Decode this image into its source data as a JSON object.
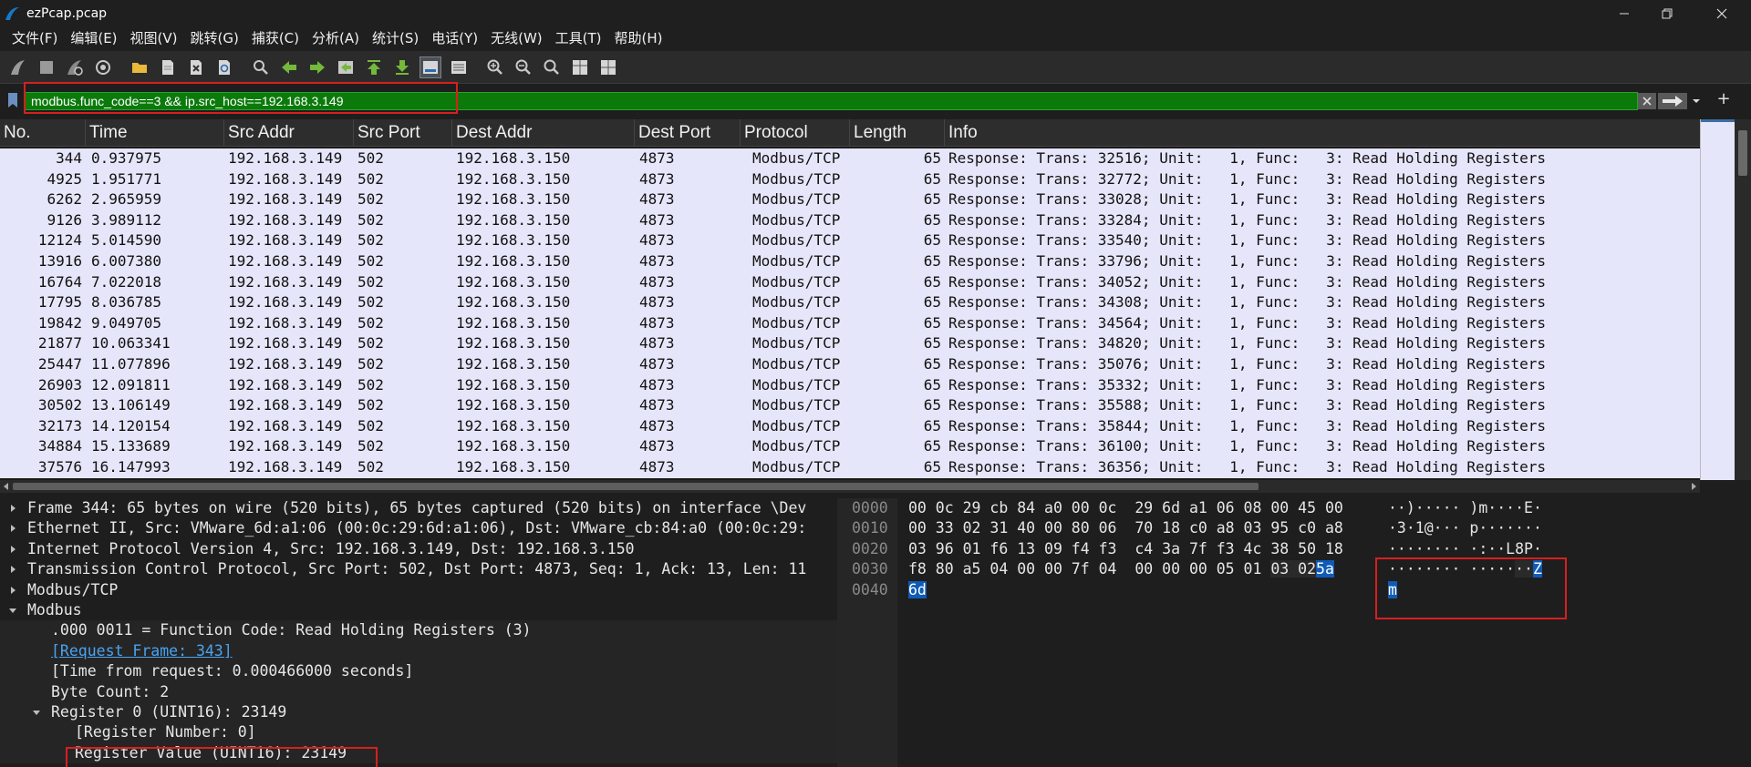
{
  "window": {
    "title": "ezPcap.pcap",
    "colors": {
      "accent_green": "#0b7a0b",
      "row_bg": "#e6e6fa",
      "highlight_blue": "#0f5bb5",
      "annotation_red": "#d81f1f"
    }
  },
  "menu": [
    "文件(F)",
    "编辑(E)",
    "视图(V)",
    "跳转(G)",
    "捕获(C)",
    "分析(A)",
    "统计(S)",
    "电话(Y)",
    "无线(W)",
    "工具(T)",
    "帮助(H)"
  ],
  "toolbar": {
    "icons": [
      "shark-fin-start-icon",
      "stop-icon",
      "restart-icon",
      "options-gear-icon",
      "open-folder-icon",
      "file-icon",
      "close-file-icon",
      "reload-icon",
      "find-icon",
      "back-arrow-icon",
      "forward-arrow-icon",
      "goto-packet-icon",
      "first-packet-icon",
      "last-packet-icon",
      "autoscroll-icon",
      "colorize-icon",
      "zoom-in-icon",
      "zoom-out-icon",
      "zoom-normal-icon",
      "resize-columns-icon",
      "layout-icon"
    ]
  },
  "filter": {
    "value": "modbus.func_code==3 && ip.src_host==192.168.3.149"
  },
  "packet_list": {
    "columns": [
      "No.",
      "Time",
      "Src Addr",
      "Src Port",
      "Dest Addr",
      "Dest Port",
      "Protocol",
      "Length",
      "Info"
    ],
    "rows": [
      {
        "no": "344",
        "time": "0.937975",
        "src": "192.168.3.149",
        "sport": "502",
        "dst": "192.168.3.150",
        "dport": "4873",
        "proto": "Modbus/TCP",
        "len": "65",
        "info": "Response: Trans: 32516; Unit:   1, Func:   3: Read Holding Registers"
      },
      {
        "no": "4925",
        "time": "1.951771",
        "src": "192.168.3.149",
        "sport": "502",
        "dst": "192.168.3.150",
        "dport": "4873",
        "proto": "Modbus/TCP",
        "len": "65",
        "info": "Response: Trans: 32772; Unit:   1, Func:   3: Read Holding Registers"
      },
      {
        "no": "6262",
        "time": "2.965959",
        "src": "192.168.3.149",
        "sport": "502",
        "dst": "192.168.3.150",
        "dport": "4873",
        "proto": "Modbus/TCP",
        "len": "65",
        "info": "Response: Trans: 33028; Unit:   1, Func:   3: Read Holding Registers"
      },
      {
        "no": "9126",
        "time": "3.989112",
        "src": "192.168.3.149",
        "sport": "502",
        "dst": "192.168.3.150",
        "dport": "4873",
        "proto": "Modbus/TCP",
        "len": "65",
        "info": "Response: Trans: 33284; Unit:   1, Func:   3: Read Holding Registers"
      },
      {
        "no": "12124",
        "time": "5.014590",
        "src": "192.168.3.149",
        "sport": "502",
        "dst": "192.168.3.150",
        "dport": "4873",
        "proto": "Modbus/TCP",
        "len": "65",
        "info": "Response: Trans: 33540; Unit:   1, Func:   3: Read Holding Registers"
      },
      {
        "no": "13916",
        "time": "6.007380",
        "src": "192.168.3.149",
        "sport": "502",
        "dst": "192.168.3.150",
        "dport": "4873",
        "proto": "Modbus/TCP",
        "len": "65",
        "info": "Response: Trans: 33796; Unit:   1, Func:   3: Read Holding Registers"
      },
      {
        "no": "16764",
        "time": "7.022018",
        "src": "192.168.3.149",
        "sport": "502",
        "dst": "192.168.3.150",
        "dport": "4873",
        "proto": "Modbus/TCP",
        "len": "65",
        "info": "Response: Trans: 34052; Unit:   1, Func:   3: Read Holding Registers"
      },
      {
        "no": "17795",
        "time": "8.036785",
        "src": "192.168.3.149",
        "sport": "502",
        "dst": "192.168.3.150",
        "dport": "4873",
        "proto": "Modbus/TCP",
        "len": "65",
        "info": "Response: Trans: 34308; Unit:   1, Func:   3: Read Holding Registers"
      },
      {
        "no": "19842",
        "time": "9.049705",
        "src": "192.168.3.149",
        "sport": "502",
        "dst": "192.168.3.150",
        "dport": "4873",
        "proto": "Modbus/TCP",
        "len": "65",
        "info": "Response: Trans: 34564; Unit:   1, Func:   3: Read Holding Registers"
      },
      {
        "no": "21877",
        "time": "10.063341",
        "src": "192.168.3.149",
        "sport": "502",
        "dst": "192.168.3.150",
        "dport": "4873",
        "proto": "Modbus/TCP",
        "len": "65",
        "info": "Response: Trans: 34820; Unit:   1, Func:   3: Read Holding Registers"
      },
      {
        "no": "25447",
        "time": "11.077896",
        "src": "192.168.3.149",
        "sport": "502",
        "dst": "192.168.3.150",
        "dport": "4873",
        "proto": "Modbus/TCP",
        "len": "65",
        "info": "Response: Trans: 35076; Unit:   1, Func:   3: Read Holding Registers"
      },
      {
        "no": "26903",
        "time": "12.091811",
        "src": "192.168.3.149",
        "sport": "502",
        "dst": "192.168.3.150",
        "dport": "4873",
        "proto": "Modbus/TCP",
        "len": "65",
        "info": "Response: Trans: 35332; Unit:   1, Func:   3: Read Holding Registers"
      },
      {
        "no": "30502",
        "time": "13.106149",
        "src": "192.168.3.149",
        "sport": "502",
        "dst": "192.168.3.150",
        "dport": "4873",
        "proto": "Modbus/TCP",
        "len": "65",
        "info": "Response: Trans: 35588; Unit:   1, Func:   3: Read Holding Registers"
      },
      {
        "no": "32173",
        "time": "14.120154",
        "src": "192.168.3.149",
        "sport": "502",
        "dst": "192.168.3.150",
        "dport": "4873",
        "proto": "Modbus/TCP",
        "len": "65",
        "info": "Response: Trans: 35844; Unit:   1, Func:   3: Read Holding Registers"
      },
      {
        "no": "34884",
        "time": "15.133689",
        "src": "192.168.3.149",
        "sport": "502",
        "dst": "192.168.3.150",
        "dport": "4873",
        "proto": "Modbus/TCP",
        "len": "65",
        "info": "Response: Trans: 36100; Unit:   1, Func:   3: Read Holding Registers"
      },
      {
        "no": "37576",
        "time": "16.147993",
        "src": "192.168.3.149",
        "sport": "502",
        "dst": "192.168.3.150",
        "dport": "4873",
        "proto": "Modbus/TCP",
        "len": "65",
        "info": "Response: Trans: 36356; Unit:   1, Func:   3: Read Holding Registers"
      }
    ]
  },
  "details": [
    {
      "indent": 0,
      "arrow": "collapsed",
      "text": "Frame 344: 65 bytes on wire (520 bits), 65 bytes captured (520 bits) on interface \\Dev"
    },
    {
      "indent": 0,
      "arrow": "collapsed",
      "text": "Ethernet II, Src: VMware_6d:a1:06 (00:0c:29:6d:a1:06), Dst: VMware_cb:84:a0 (00:0c:29:"
    },
    {
      "indent": 0,
      "arrow": "collapsed",
      "text": "Internet Protocol Version 4, Src: 192.168.3.149, Dst: 192.168.3.150"
    },
    {
      "indent": 0,
      "arrow": "collapsed",
      "text": "Transmission Control Protocol, Src Port: 502, Dst Port: 4873, Seq: 1, Ack: 13, Len: 11"
    },
    {
      "indent": 0,
      "arrow": "collapsed",
      "text": "Modbus/TCP"
    },
    {
      "indent": 0,
      "arrow": "expanded",
      "text": "Modbus"
    },
    {
      "indent": 1,
      "arrow": "none",
      "text": ".000 0011 = Function Code: Read Holding Registers (3)"
    },
    {
      "indent": 1,
      "arrow": "none",
      "text": "[Request Frame: 343]",
      "link": true
    },
    {
      "indent": 1,
      "arrow": "none",
      "text": "[Time from request: 0.000466000 seconds]"
    },
    {
      "indent": 1,
      "arrow": "none",
      "text": "Byte Count: 2"
    },
    {
      "indent": 1,
      "arrow": "expanded",
      "text": "Register 0 (UINT16): 23149"
    },
    {
      "indent": 2,
      "arrow": "none",
      "text": "[Register Number: 0]"
    },
    {
      "indent": 2,
      "arrow": "none",
      "text": "Register Value (UINT16): 23149"
    }
  ],
  "bytes": [
    {
      "off": "0000",
      "hex": "00 0c 29 cb 84 a0 00 0c  29 6d a1 06 08 00 45 00",
      "asc": "··)····· )m····E·"
    },
    {
      "off": "0010",
      "hex": "00 33 02 31 40 00 80 06  70 18 c0 a8 03 95 c0 a8",
      "asc": "·3·1@··· p·······"
    },
    {
      "off": "0020",
      "hex": "03 96 01 f6 13 09 f4 f3  c4 3a 7f f3 4c 38 50 18",
      "asc": "········ ·:··L8P·"
    },
    {
      "off": "0030",
      "hex_pre": "f8 80 a5 04 00 00 7f 04  00 00 00 05 01 ",
      "hex_dim": "03 02",
      "hex_hl": "5a",
      "asc_pre": "········ ·····",
      "asc_dim": "··",
      "asc_hl": "Z"
    },
    {
      "off": "0040",
      "hex_hl": "6d",
      "asc_hl": "m"
    }
  ]
}
